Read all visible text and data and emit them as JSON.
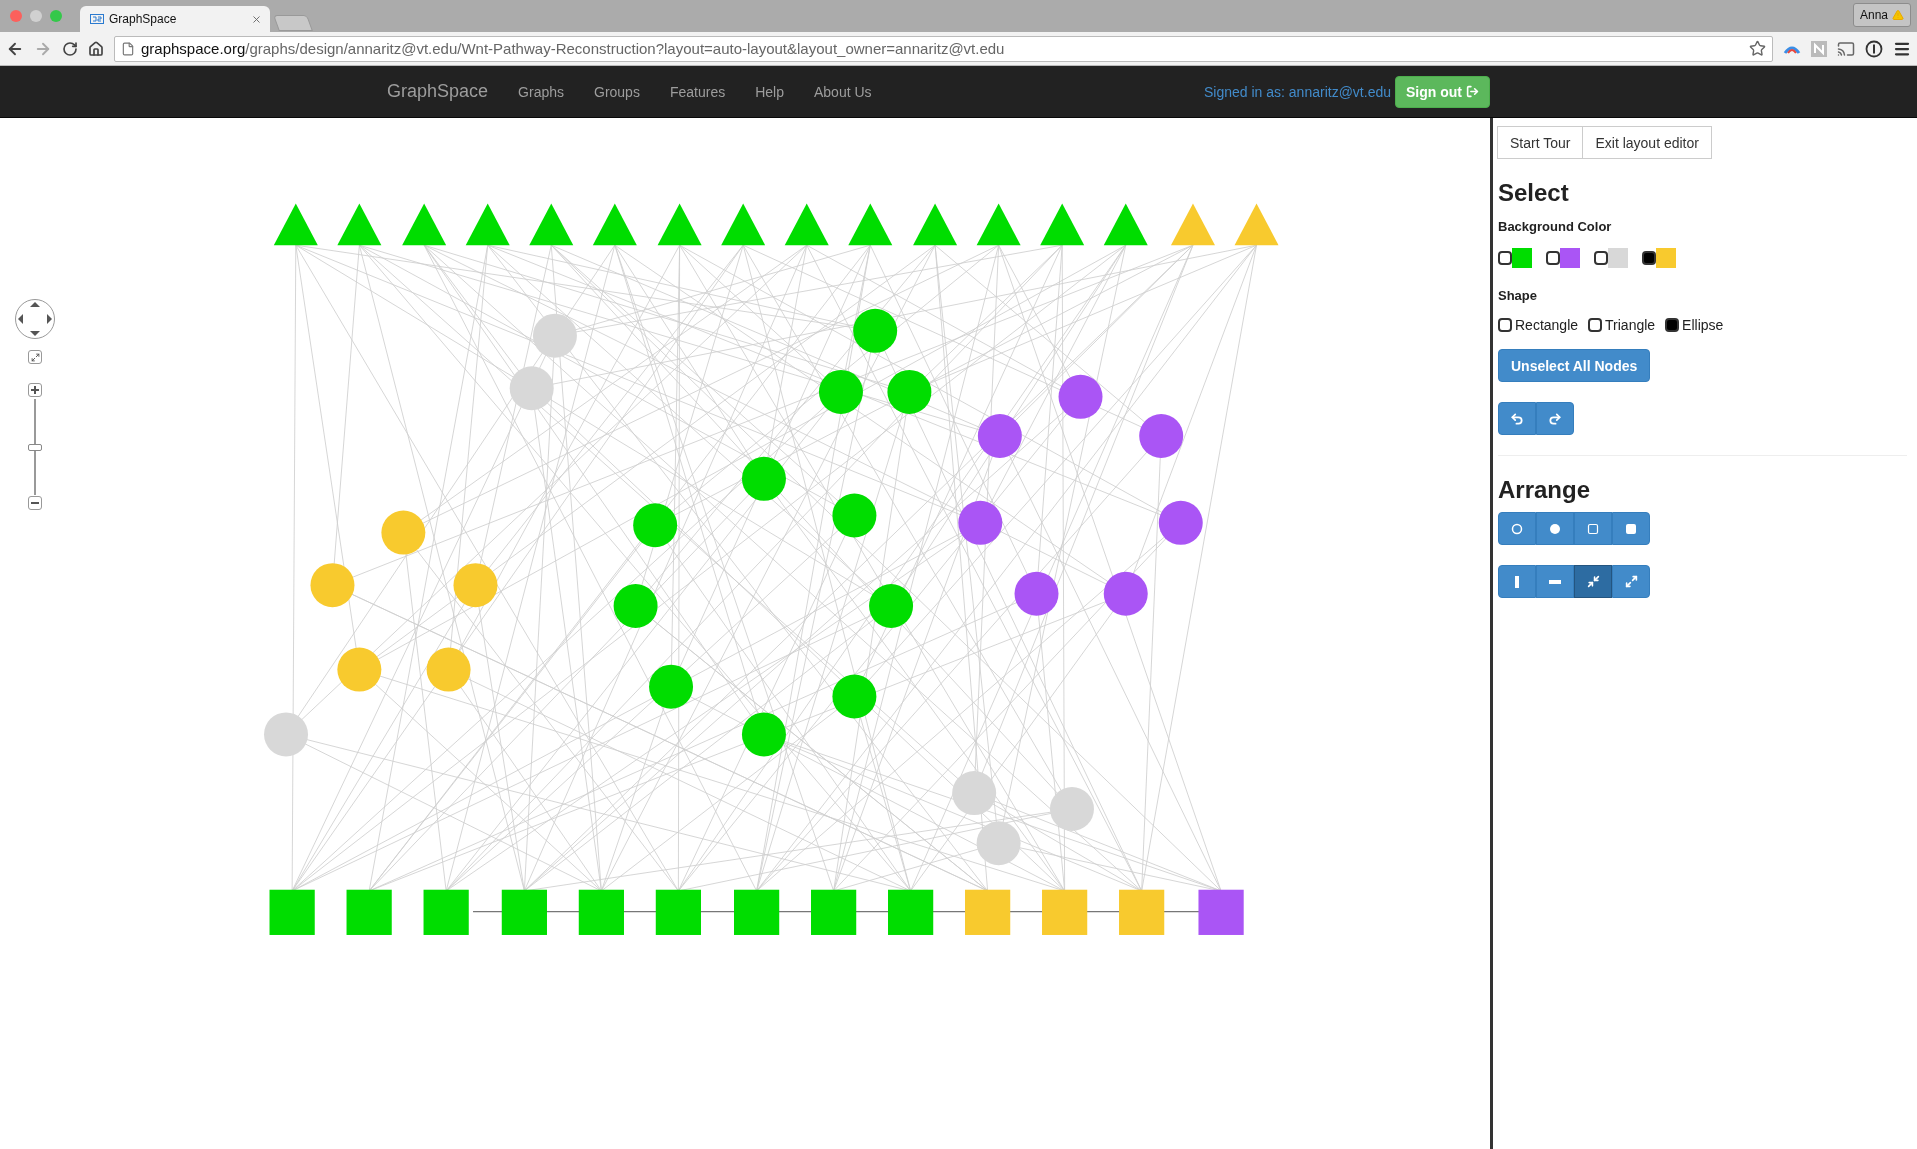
{
  "browser": {
    "tab_title": "GraphSpace",
    "profile": "Anna",
    "url": {
      "host": "graphspace.org",
      "path": "/graphs/design/annaritz@vt.edu/Wnt-Pathway-Reconstruction?layout=auto-layout&layout_owner=annaritz@vt.edu"
    }
  },
  "navbar": {
    "brand": "GraphSpace",
    "links": [
      "Graphs",
      "Groups",
      "Features",
      "Help",
      "About Us"
    ],
    "signed_in": "Signed in as: annaritz@vt.edu",
    "sign_out": "Sign out"
  },
  "zoom_control": {
    "level": 0.5
  },
  "panel": {
    "buttons": [
      "Start Tour",
      "Exit layout editor"
    ],
    "select_title": "Select",
    "background_label": "Background Color",
    "colors": [
      {
        "color": "#00dd00",
        "checked": false
      },
      {
        "color": "#aa55f5",
        "checked": false
      },
      {
        "color": "#d8d8d8",
        "checked": false
      },
      {
        "color": "#f8ca2e",
        "checked": true
      }
    ],
    "shape_label": "Shape",
    "shapes": [
      {
        "label": "Rectangle",
        "checked": false
      },
      {
        "label": "Triangle",
        "checked": false
      },
      {
        "label": "Ellipse",
        "checked": true
      }
    ],
    "unselect": "Unselect All Nodes",
    "arrange_title": "Arrange",
    "arrange_rows": [
      [
        {
          "kind": "ring",
          "selected": false
        },
        {
          "kind": "disc",
          "selected": false
        },
        {
          "kind": "square",
          "selected": false
        },
        {
          "kind": "block",
          "selected": false
        }
      ],
      [
        {
          "kind": "vertical",
          "selected": false
        },
        {
          "kind": "horizontal",
          "selected": false
        },
        {
          "kind": "compress",
          "selected": true
        },
        {
          "kind": "expand",
          "selected": false
        }
      ]
    ]
  }
}
